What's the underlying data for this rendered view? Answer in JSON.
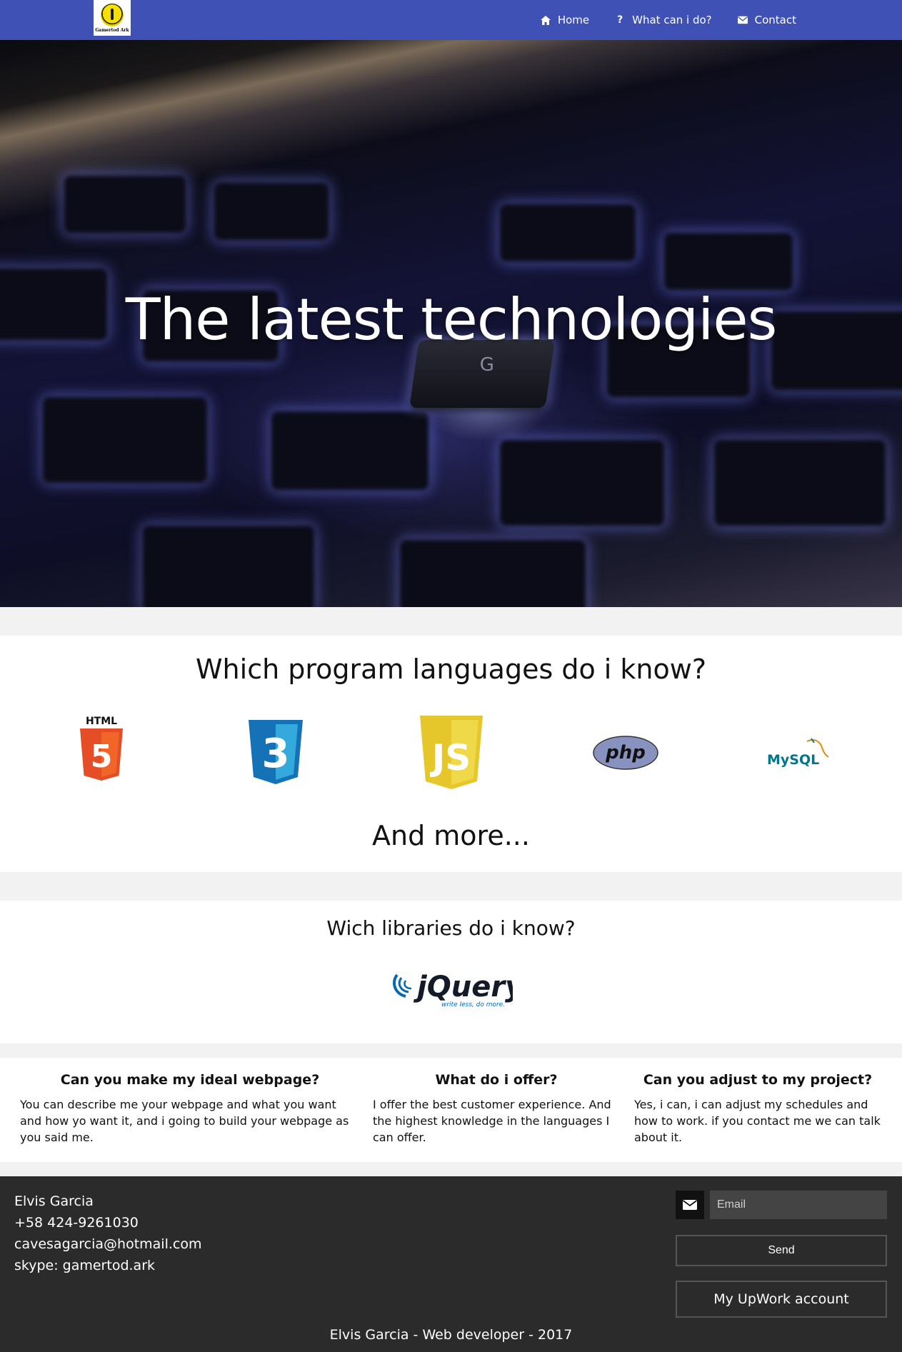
{
  "navbar": {
    "logo_text": "Gamertod Ark",
    "items": [
      {
        "label": "Home",
        "icon": "home-icon"
      },
      {
        "label": "What can i do?",
        "icon": "question-icon"
      },
      {
        "label": "Contact",
        "icon": "envelope-icon"
      }
    ],
    "background": "#3f51b5"
  },
  "hero": {
    "title": "The latest technologies",
    "key_letter": "G"
  },
  "languages": {
    "title": "Which program languages do i know?",
    "logos": [
      {
        "name": "html5-logo",
        "label": "HTML",
        "mark": "5"
      },
      {
        "name": "css3-logo",
        "mark": "3"
      },
      {
        "name": "javascript-logo",
        "mark": "JS"
      },
      {
        "name": "php-logo",
        "label": "php"
      },
      {
        "name": "mysql-logo",
        "label": "MySQL"
      }
    ],
    "more": "And more..."
  },
  "libraries": {
    "title": "Wich libraries do i know?",
    "jquery_label": "jQuery",
    "jquery_tagline": "write less, do more."
  },
  "faq": [
    {
      "heading": "Can you make my ideal webpage?",
      "text": "You can describe me your webpage and what you want and how yo want it, and i going to build your webpage as you said me."
    },
    {
      "heading": "What do i offer?",
      "text": "I offer the best customer experience. And the highest knowledge in the languages I can offer."
    },
    {
      "heading": "Can you adjust to my project?",
      "text": "Yes, i can, i can adjust my schedules and how to work. if you contact me we can talk about it."
    }
  ],
  "footer": {
    "name": "Elvis Garcia",
    "phone": "+58 424-9261030",
    "email": "cavesagarcia@hotmail.com",
    "skype": "skype: gamertod.ark",
    "email_placeholder": "Email",
    "send_label": "Send",
    "upwork_label": "My UpWork account",
    "copyright": "Elvis Garcia - Web developer - 2017"
  }
}
